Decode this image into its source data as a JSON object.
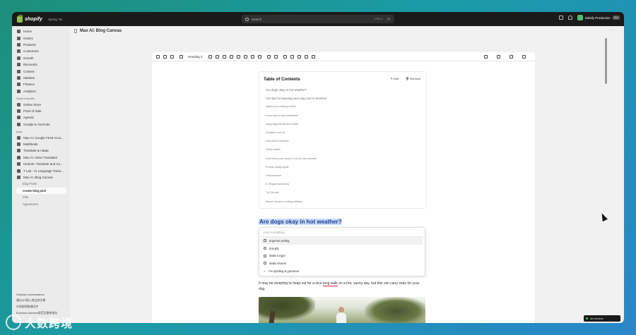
{
  "topbar": {
    "logo_text": "shopify",
    "edition": "Spring '26",
    "search_placeholder": "Search",
    "search_shortcut": "CTRL K",
    "search_kbd2": "K",
    "store_name": "Salsify Production",
    "store_badge": "Dev"
  },
  "sidebar": {
    "items": [
      "Home",
      "Orders",
      "Products",
      "Customers",
      "Growth",
      "Discounts",
      "Content",
      "Markets",
      "Finance",
      "Analytics"
    ],
    "sales_channels_label": "Sales channels",
    "sales_channels": [
      "Online Store",
      "Point of Sale",
      "Agentic",
      "Google & YouTube"
    ],
    "apps_label": "Apps",
    "apps": [
      "Max AI: Google Feed Acco...",
      "Multifeeds",
      "Translate & Adapt",
      "Max AI: Omni Translator",
      "Hextom: Translate and Cu...",
      "T Lab - AI Language Trans...",
      "Max AI: Blog Canvas"
    ],
    "app_sub": [
      "Blog Posts",
      "Create blog post",
      "Plan",
      "Appearance"
    ],
    "bottom": [
      "Sidekick conversations",
      "通过API接入商品库文章",
      "市场规划数据同步",
      "Business Address规范及更新地址"
    ]
  },
  "main": {
    "page_title": "Max AI: Blog Canvas",
    "more": "···"
  },
  "toolbar": {
    "heading": "Heading 2"
  },
  "toc": {
    "title": "Table of Contents",
    "edit": "Edit",
    "remove": "Remove",
    "items": [
      "Are dogs okay in hot weather?",
      "Our tips for keeping your dog cool in Summer",
      "Adjust your walking routine",
      "Know how to spot heatstroke",
      "Apply dog-friendly sun cream",
      "Circulate cool air",
      "Keep them hydrated",
      "Damp towels",
      "Don't leave your dog in a hot car this summer",
      "Provide shady spots",
      "Limit exercise",
      "8. Regular grooming",
      "Try Get wet",
      "Bonus: Invest in cooling clothing"
    ]
  },
  "content": {
    "selected_heading": "Are dogs okay in hot weather?",
    "paragraph_1": "It may be tempting to head out for a nice",
    "paragraph_u": "long walk",
    "paragraph_2": " on a hot, sunny day, but this can carry risks for your dog."
  },
  "ai_menu": {
    "placeholder": "Ask AI anything...",
    "options": [
      "Improve writing",
      "Emojify",
      "Make longer",
      "Make shorter",
      "Fix spelling & grammar"
    ]
  },
  "toast": {
    "text": "dev preview"
  },
  "watermark": {
    "text": "大数跨境"
  }
}
